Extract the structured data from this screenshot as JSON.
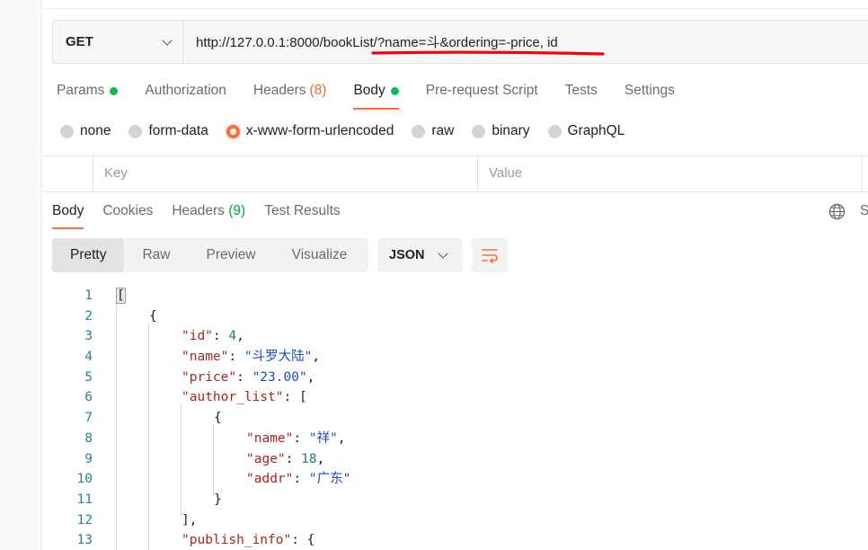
{
  "request": {
    "method": "GET",
    "url": "http://127.0.0.1:8000/bookList/?name=斗&ordering=-price, id"
  },
  "request_tabs": [
    {
      "label": "Params",
      "dot": true
    },
    {
      "label": "Authorization"
    },
    {
      "label": "Headers",
      "count": "(8)"
    },
    {
      "label": "Body",
      "dot": true,
      "active": true
    },
    {
      "label": "Pre-request Script"
    },
    {
      "label": "Tests"
    },
    {
      "label": "Settings"
    }
  ],
  "body_modes": [
    {
      "label": "none"
    },
    {
      "label": "form-data"
    },
    {
      "label": "x-www-form-urlencoded",
      "checked": true
    },
    {
      "label": "raw"
    },
    {
      "label": "binary"
    },
    {
      "label": "GraphQL"
    }
  ],
  "kv_table": {
    "key_placeholder": "Key",
    "value_placeholder": "Value"
  },
  "response_tabs": [
    {
      "label": "Body",
      "active": true
    },
    {
      "label": "Cookies"
    },
    {
      "label": "Headers",
      "count": "(9)"
    },
    {
      "label": "Test Results"
    }
  ],
  "response_right_label": "S",
  "view_modes": [
    "Pretty",
    "Raw",
    "Preview",
    "Visualize"
  ],
  "format": "JSON",
  "code_lines": [
    {
      "n": "1",
      "indent": 0,
      "tokens": [
        [
          "p",
          "["
        ]
      ]
    },
    {
      "n": "2",
      "indent": 1,
      "tokens": [
        [
          "p",
          "{"
        ]
      ]
    },
    {
      "n": "3",
      "indent": 2,
      "tokens": [
        [
          "k",
          "\"id\""
        ],
        [
          "p",
          ": "
        ],
        [
          "n",
          "4"
        ],
        [
          "p",
          ","
        ]
      ]
    },
    {
      "n": "4",
      "indent": 2,
      "tokens": [
        [
          "k",
          "\"name\""
        ],
        [
          "p",
          ": "
        ],
        [
          "s",
          "\"斗罗大陆\""
        ],
        [
          "p",
          ","
        ]
      ]
    },
    {
      "n": "5",
      "indent": 2,
      "tokens": [
        [
          "k",
          "\"price\""
        ],
        [
          "p",
          ": "
        ],
        [
          "s",
          "\"23.00\""
        ],
        [
          "p",
          ","
        ]
      ]
    },
    {
      "n": "6",
      "indent": 2,
      "tokens": [
        [
          "k",
          "\"author_list\""
        ],
        [
          "p",
          ": ["
        ]
      ]
    },
    {
      "n": "7",
      "indent": 3,
      "tokens": [
        [
          "p",
          "{"
        ]
      ]
    },
    {
      "n": "8",
      "indent": 4,
      "tokens": [
        [
          "k",
          "\"name\""
        ],
        [
          "p",
          ": "
        ],
        [
          "s",
          "\"祥\""
        ],
        [
          "p",
          ","
        ]
      ]
    },
    {
      "n": "9",
      "indent": 4,
      "tokens": [
        [
          "k",
          "\"age\""
        ],
        [
          "p",
          ": "
        ],
        [
          "n",
          "18"
        ],
        [
          "p",
          ","
        ]
      ]
    },
    {
      "n": "10",
      "indent": 4,
      "tokens": [
        [
          "k",
          "\"addr\""
        ],
        [
          "p",
          ": "
        ],
        [
          "s",
          "\"广东\""
        ]
      ]
    },
    {
      "n": "11",
      "indent": 3,
      "tokens": [
        [
          "p",
          "}"
        ]
      ]
    },
    {
      "n": "12",
      "indent": 2,
      "tokens": [
        [
          "p",
          "],"
        ]
      ]
    },
    {
      "n": "13",
      "indent": 2,
      "tokens": [
        [
          "k",
          "\"publish_info\""
        ],
        [
          "p",
          ": {"
        ]
      ]
    }
  ],
  "colors": {
    "accent": "#ff6c37",
    "dot_green": "#0cbb52",
    "annotation_red": "#ff0000"
  }
}
